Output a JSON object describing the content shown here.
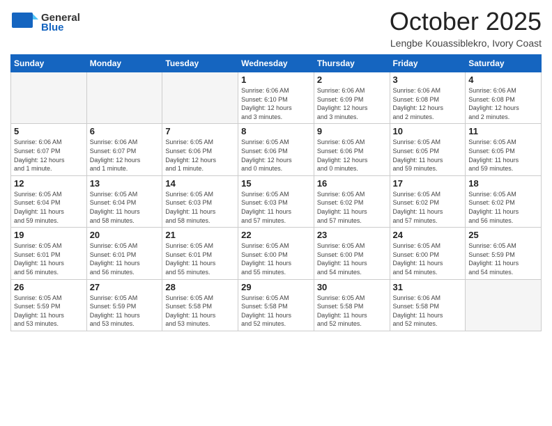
{
  "header": {
    "logo_general": "General",
    "logo_blue": "Blue",
    "month_year": "October 2025",
    "location": "Lengbe Kouassiblekro, Ivory Coast"
  },
  "days_of_week": [
    "Sunday",
    "Monday",
    "Tuesday",
    "Wednesday",
    "Thursday",
    "Friday",
    "Saturday"
  ],
  "weeks": [
    [
      {
        "day": "",
        "info": ""
      },
      {
        "day": "",
        "info": ""
      },
      {
        "day": "",
        "info": ""
      },
      {
        "day": "1",
        "info": "Sunrise: 6:06 AM\nSunset: 6:10 PM\nDaylight: 12 hours\nand 3 minutes."
      },
      {
        "day": "2",
        "info": "Sunrise: 6:06 AM\nSunset: 6:09 PM\nDaylight: 12 hours\nand 3 minutes."
      },
      {
        "day": "3",
        "info": "Sunrise: 6:06 AM\nSunset: 6:08 PM\nDaylight: 12 hours\nand 2 minutes."
      },
      {
        "day": "4",
        "info": "Sunrise: 6:06 AM\nSunset: 6:08 PM\nDaylight: 12 hours\nand 2 minutes."
      }
    ],
    [
      {
        "day": "5",
        "info": "Sunrise: 6:06 AM\nSunset: 6:07 PM\nDaylight: 12 hours\nand 1 minute."
      },
      {
        "day": "6",
        "info": "Sunrise: 6:06 AM\nSunset: 6:07 PM\nDaylight: 12 hours\nand 1 minute."
      },
      {
        "day": "7",
        "info": "Sunrise: 6:05 AM\nSunset: 6:06 PM\nDaylight: 12 hours\nand 1 minute."
      },
      {
        "day": "8",
        "info": "Sunrise: 6:05 AM\nSunset: 6:06 PM\nDaylight: 12 hours\nand 0 minutes."
      },
      {
        "day": "9",
        "info": "Sunrise: 6:05 AM\nSunset: 6:06 PM\nDaylight: 12 hours\nand 0 minutes."
      },
      {
        "day": "10",
        "info": "Sunrise: 6:05 AM\nSunset: 6:05 PM\nDaylight: 11 hours\nand 59 minutes."
      },
      {
        "day": "11",
        "info": "Sunrise: 6:05 AM\nSunset: 6:05 PM\nDaylight: 11 hours\nand 59 minutes."
      }
    ],
    [
      {
        "day": "12",
        "info": "Sunrise: 6:05 AM\nSunset: 6:04 PM\nDaylight: 11 hours\nand 59 minutes."
      },
      {
        "day": "13",
        "info": "Sunrise: 6:05 AM\nSunset: 6:04 PM\nDaylight: 11 hours\nand 58 minutes."
      },
      {
        "day": "14",
        "info": "Sunrise: 6:05 AM\nSunset: 6:03 PM\nDaylight: 11 hours\nand 58 minutes."
      },
      {
        "day": "15",
        "info": "Sunrise: 6:05 AM\nSunset: 6:03 PM\nDaylight: 11 hours\nand 57 minutes."
      },
      {
        "day": "16",
        "info": "Sunrise: 6:05 AM\nSunset: 6:02 PM\nDaylight: 11 hours\nand 57 minutes."
      },
      {
        "day": "17",
        "info": "Sunrise: 6:05 AM\nSunset: 6:02 PM\nDaylight: 11 hours\nand 57 minutes."
      },
      {
        "day": "18",
        "info": "Sunrise: 6:05 AM\nSunset: 6:02 PM\nDaylight: 11 hours\nand 56 minutes."
      }
    ],
    [
      {
        "day": "19",
        "info": "Sunrise: 6:05 AM\nSunset: 6:01 PM\nDaylight: 11 hours\nand 56 minutes."
      },
      {
        "day": "20",
        "info": "Sunrise: 6:05 AM\nSunset: 6:01 PM\nDaylight: 11 hours\nand 56 minutes."
      },
      {
        "day": "21",
        "info": "Sunrise: 6:05 AM\nSunset: 6:01 PM\nDaylight: 11 hours\nand 55 minutes."
      },
      {
        "day": "22",
        "info": "Sunrise: 6:05 AM\nSunset: 6:00 PM\nDaylight: 11 hours\nand 55 minutes."
      },
      {
        "day": "23",
        "info": "Sunrise: 6:05 AM\nSunset: 6:00 PM\nDaylight: 11 hours\nand 54 minutes."
      },
      {
        "day": "24",
        "info": "Sunrise: 6:05 AM\nSunset: 6:00 PM\nDaylight: 11 hours\nand 54 minutes."
      },
      {
        "day": "25",
        "info": "Sunrise: 6:05 AM\nSunset: 5:59 PM\nDaylight: 11 hours\nand 54 minutes."
      }
    ],
    [
      {
        "day": "26",
        "info": "Sunrise: 6:05 AM\nSunset: 5:59 PM\nDaylight: 11 hours\nand 53 minutes."
      },
      {
        "day": "27",
        "info": "Sunrise: 6:05 AM\nSunset: 5:59 PM\nDaylight: 11 hours\nand 53 minutes."
      },
      {
        "day": "28",
        "info": "Sunrise: 6:05 AM\nSunset: 5:58 PM\nDaylight: 11 hours\nand 53 minutes."
      },
      {
        "day": "29",
        "info": "Sunrise: 6:05 AM\nSunset: 5:58 PM\nDaylight: 11 hours\nand 52 minutes."
      },
      {
        "day": "30",
        "info": "Sunrise: 6:05 AM\nSunset: 5:58 PM\nDaylight: 11 hours\nand 52 minutes."
      },
      {
        "day": "31",
        "info": "Sunrise: 6:06 AM\nSunset: 5:58 PM\nDaylight: 11 hours\nand 52 minutes."
      },
      {
        "day": "",
        "info": ""
      }
    ]
  ]
}
